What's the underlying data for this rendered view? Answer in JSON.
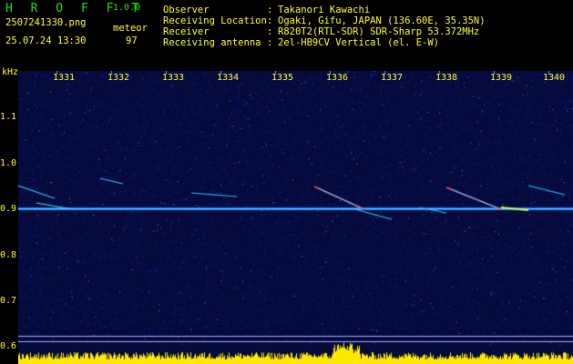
{
  "header": {
    "app_title": "H R O F F T",
    "app_version": "1.0.0",
    "filename": "2507241330.png",
    "datetime": "25.07.24 13:30",
    "meteor_label": "meteor",
    "meteor_count": "97",
    "fields": [
      {
        "label": "Observer",
        "value": "Takanori Kawachi"
      },
      {
        "label": "Receiving Location",
        "value": "Ogaki, Gifu, JAPAN (136.60E, 35.35N)"
      },
      {
        "label": "Receiver",
        "value": "R820T2(RTL-SDR) SDR-Sharp 53.372MHz"
      },
      {
        "label": "Receiving antenna",
        "value": "2el-HB9CV Vertical (el. E-W)"
      }
    ],
    "separator": ":"
  },
  "axes": {
    "y_unit": "kHz",
    "y_ticks": [
      "1.1",
      "1.0",
      "0.9",
      "0.8",
      "0.7",
      "0.6"
    ],
    "x_ticks": [
      "1331",
      "1332",
      "1333",
      "1334",
      "1335",
      "1336",
      "1337",
      "1338",
      "1339",
      "1340"
    ]
  },
  "colors": {
    "text": "#ffff33",
    "title": "#22dd22",
    "background": "#000000",
    "noise": "#0a1a7a"
  }
}
